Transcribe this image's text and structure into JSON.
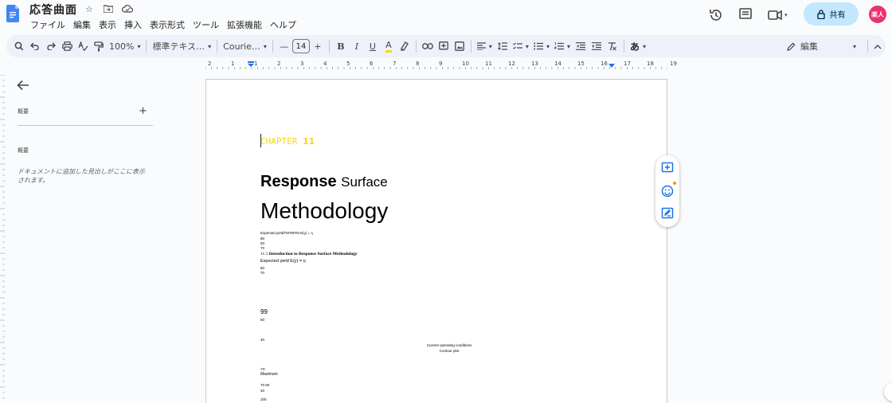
{
  "app": {
    "doc_title": "応答曲面",
    "menu": [
      "ファイル",
      "編集",
      "表示",
      "挿入",
      "表示形式",
      "ツール",
      "拡張機能",
      "ヘルプ"
    ],
    "share_label": "共有",
    "avatar_label": "楽人",
    "accent_color": "#1a73e8",
    "share_bg": "#c2e7ff"
  },
  "toolbar": {
    "zoom": "100%",
    "style": "標準テキス…",
    "font": "Courie…",
    "font_size": "14",
    "bold": "B",
    "italic": "I",
    "underline": "U",
    "text_color": "A",
    "ime": "あ",
    "mode": "編集"
  },
  "ruler": {
    "ticks": [
      "2",
      "1",
      "1",
      "2",
      "3",
      "4",
      "5",
      "6",
      "7",
      "8",
      "9",
      "10",
      "11",
      "12",
      "13",
      "14",
      "15",
      "16",
      "17",
      "18",
      "19"
    ]
  },
  "sidebar": {
    "outline_title": "概要",
    "summary_title": "概要",
    "empty_text": "ドキュメントに追加した見出しがここに表示されます。"
  },
  "document": {
    "chapter_word": "CHAPTER",
    "chapter_num": "11",
    "heading_bold": "Response",
    "heading_rest": "Surface",
    "heading2": "Methodology",
    "line1": "Expected yieldTMTMTM E(y) = η",
    "line2": "80",
    "line3": "50",
    "line4": "70",
    "line5_num": "11.1",
    "line5_text": "Introduction to Response Surface Methodology",
    "line6": "Expected yield E(y) = η",
    "line7": "60",
    "line8": "70",
    "n99": "99",
    "n50": "50",
    "n40": "40",
    "current_conditions": "Current operating conditions",
    "contour_plot": "Contour plot",
    "y0": "Y0",
    "maximum": "Maximum",
    "n7060": "70 60",
    "n40b": "40",
    "n100": "100"
  },
  "icons": {
    "history": "history-icon",
    "comments": "comment-icon",
    "meet": "video-icon",
    "lock": "lock-icon",
    "add_comment": "add-comment-icon",
    "emoji": "emoji-icon",
    "suggest": "suggest-edit-icon"
  }
}
